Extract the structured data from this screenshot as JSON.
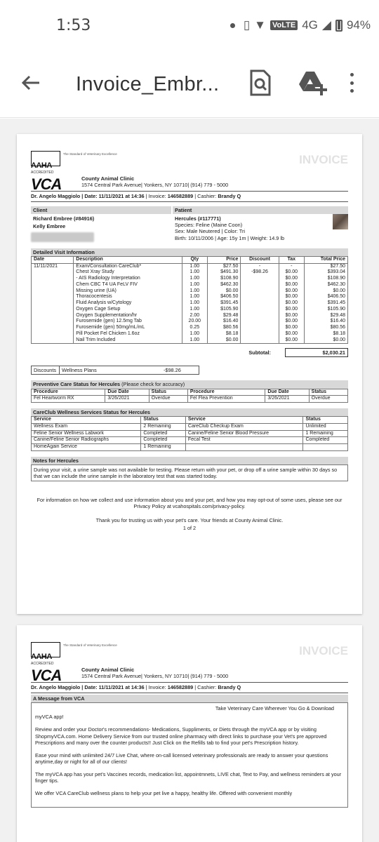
{
  "status_bar": {
    "time": "1:53",
    "network": "4G",
    "volte": "VoLTE",
    "battery": "94%"
  },
  "app_bar": {
    "title": "Invoice_Embr..."
  },
  "invoice": {
    "accreditation": "ACCREDITED",
    "aaha": "AAHA",
    "aaha_standard": "The Standard of Veterinary Excellence",
    "brand": "VCA",
    "watermark": "INVOICE",
    "clinic_name": "County Animal Clinic",
    "clinic_address": "1574 Central Park Avenue| Yonkers, NY 10710| (914) 779 - 5000",
    "doc_line_prefix": "Dr. Angelo Maggiolo | Date: ",
    "date": "11/11/2021 at 14:36",
    "invoice_prefix": " | Invoice: ",
    "invoice_no": "146582889",
    "cashier_prefix": " | Cashier: ",
    "cashier": "Brandy Q",
    "client_label": "Client",
    "client_name": "Richard Embree (#84916)",
    "client_name2": "Kelly Embree",
    "patient_label": "Patient",
    "patient_name": "Hercules (#117771)",
    "species": "Species: Feline (Maine Coon)",
    "sex": "Sex: Male Neutered | Color: Tri",
    "birth": "Birth: 10/11/2006 | Age: 15y 1m | Weight: 14.9 lb",
    "detailed_header": "Detailed Visit Information",
    "columns": [
      "Date",
      "Description",
      "Qty",
      "Price",
      "Discount",
      "Tax",
      "Total Price"
    ],
    "rows": [
      [
        "11/11/2021",
        "Exam/Consultation CareClub*",
        "1.00",
        "$27.50",
        "-",
        "-",
        "$27.50"
      ],
      [
        "",
        "Chest Xray Study",
        "1.00",
        "$491.30",
        "-$98.26",
        "$0.00",
        "$393.04"
      ],
      [
        "",
        "   -  AIS Radiology Interpretation",
        "1.00",
        "$108.90",
        "",
        "$0.00",
        "$108.90"
      ],
      [
        "",
        "Chem CBC T4 UA FeLV FIV",
        "1.00",
        "$462.30",
        "",
        "$0.00",
        "$462.30"
      ],
      [
        "",
        "Missing urine (UA)",
        "1.00",
        "$0.00",
        "",
        "$0.00",
        "$0.00"
      ],
      [
        "",
        "Thoracocentesis",
        "1.00",
        "$406.50",
        "",
        "$0.00",
        "$406.50"
      ],
      [
        "",
        "Fluid Analysis w/Cytology",
        "1.00",
        "$391.45",
        "",
        "$0.00",
        "$391.45"
      ],
      [
        "",
        "Oxygen Cage Setup",
        "1.00",
        "$105.90",
        "",
        "$0.00",
        "$105.90"
      ],
      [
        "",
        "Oxygen Supplementation/hr",
        "2.00",
        "$29.48",
        "",
        "$0.00",
        "$29.48"
      ],
      [
        "",
        "Furosemide (gen) 12.5mg Tab",
        "20.00",
        "$16.40",
        "",
        "$0.00",
        "$16.40"
      ],
      [
        "",
        "Furosemide (gen) 50mg/mL/mL",
        "0.25",
        "$80.56",
        "",
        "$0.00",
        "$80.56"
      ],
      [
        "",
        "Pill Pocket Fel Chicken 1.6oz",
        "1.00",
        "$8.18",
        "",
        "$0.00",
        "$8.18"
      ],
      [
        "",
        "Nail Trim Included",
        "1.00",
        "$0.00",
        "",
        "$0.00",
        "$0.00"
      ]
    ],
    "subtotal_label": "Subtotal:",
    "subtotal": "$2,030.21",
    "discounts_label": "Discounts",
    "discounts_plan": "Wellness Plans",
    "discounts_amount": "-$98.26",
    "preventive_header": "Preventive Care Status for Hercules",
    "preventive_note": "(Please check for accuracy)",
    "prev_cols": [
      "Procedure",
      "Due Date",
      "Status",
      "Procedure",
      "Due Date",
      "Status"
    ],
    "prev_row": [
      "Fel Heartworm RX",
      "3/26/2021",
      "Overdue",
      "Fel Flea Prevention",
      "3/26/2021",
      "Overdue"
    ],
    "careclub_header": "CareClub Wellness Services Status for Hercules",
    "cc_cols": [
      "Service",
      "Status",
      "Service",
      "Status"
    ],
    "cc_rows": [
      [
        "Wellness Exam",
        "2 Remaining",
        "CareClub Checkup Exam",
        "Unlimited"
      ],
      [
        "Feline Senior Wellness Labwork",
        "Completed",
        "Canine/Feline Senior Blood Pressure",
        "1 Remaining"
      ],
      [
        "Canine/Feline Senior Radiographs",
        "Completed",
        "Fecal Test",
        "Completed"
      ],
      [
        "HomeAgain Service",
        "1 Remaining",
        "",
        ""
      ]
    ],
    "notes_header": "Notes for Hercules",
    "notes_text": "During your visit, a urine sample was not available for testing.  Please return with your pet, or drop off a urine sample within 30 days so that we can include the urine sample in the laboratory test that was started today.",
    "privacy": "For information on how we collect and use information about you and your pet, and how you may opt-out of some uses, please see our Privacy Policy at vcahospitals.com/privacy-policy.",
    "thanks": "Thank you for trusting us with your pet's care.  Your friends at County Animal Clinic.",
    "page_num": "1 of 2"
  },
  "page2": {
    "message_header": "A Message from VCA",
    "tagline": "Take Veterinary Care Wherever You Go & Download",
    "p0": "myVCA app!",
    "p1": "Review and order your Doctor's recommendations- Medications, Suppliments, or Diets through the myVCA app or by visiting ShopmyVCA.com. Home Delivery Service from our trusted online pharmacy with direct links to purchase your Vet's pre approved Prescriptions and many over the counter products!! Just Click on the Refills tab to find your pet's Prescription history.",
    "p2": "Ease your mind with unlimited 24/7 Live Chat, where on-call licensed veterinary professionals are ready to answer your questions anytime,day or night for all of our clients!",
    "p3": "The myVCA app has your pet's Vaccines records, medication list, appointmnets, LIVE chat, Text to Pay, and wellness reminders at your finger tips.",
    "p4": "We offer VCA CareClub wellness plans to help your pet live a happy, healthy life. Offered with convenient monthly"
  }
}
